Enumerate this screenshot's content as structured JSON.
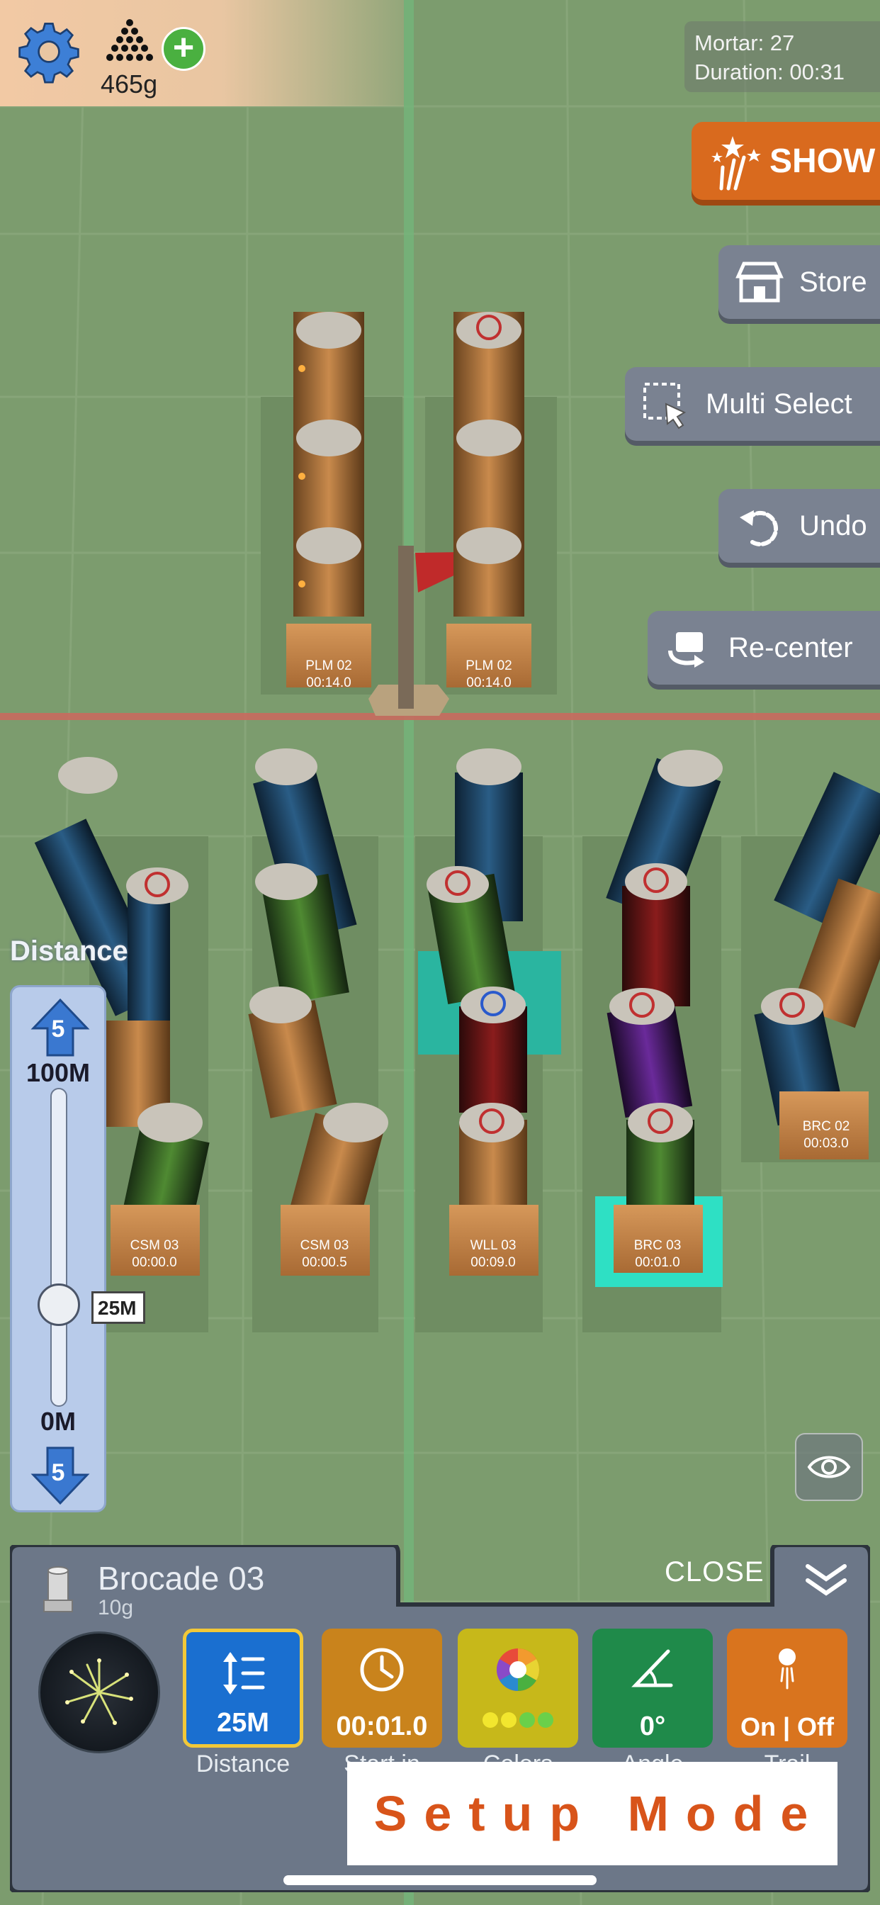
{
  "resources": {
    "grams": "465g"
  },
  "info": {
    "mortar": "Mortar: 27",
    "duration": "Duration: 00:31"
  },
  "buttons": {
    "show": "SHOW",
    "store": "Store",
    "multi_select": "Multi Select",
    "undo": "Undo",
    "recenter": "Re-center"
  },
  "distance": {
    "label": "Distance",
    "step_up": "5",
    "max": "100M",
    "current": "25M",
    "min": "0M",
    "step_down": "5",
    "level_fraction": 0.25
  },
  "mortars": {
    "top_left": {
      "name": "PLM 02",
      "time": "00:14.0"
    },
    "top_right": {
      "name": "PLM 02",
      "time": "00:14.0"
    },
    "csm_a": {
      "name": "CSM 03",
      "time": "00:00.0"
    },
    "csm_b": {
      "name": "CSM 03",
      "time": "00:00.5"
    },
    "wll": {
      "name": "WLL 03",
      "time": "00:09.0"
    },
    "brc_selected": {
      "name": "BRC 03",
      "time": "00:01.0"
    },
    "brc_right": {
      "name": "BRC 02",
      "time": "00:03.0"
    }
  },
  "selected_item": {
    "name": "Brocade 03",
    "weight": "10g",
    "close_label": "CLOSE"
  },
  "settings": [
    {
      "label": "Distance",
      "value": "25M",
      "icon": "distance-icon",
      "color": "#1a6fd0"
    },
    {
      "label": "Start in",
      "value": "00:01.0",
      "icon": "clock-icon",
      "color": "#c9831c"
    },
    {
      "label": "Colors",
      "value": "",
      "icon": "color-wheel-icon",
      "color": "#c7b81a"
    },
    {
      "label": "Angle",
      "value": "0°",
      "icon": "angle-icon",
      "color": "#1f8a4a"
    },
    {
      "label": "Trail",
      "value": "On | Off",
      "icon": "trail-icon",
      "color": "#d9741e"
    }
  ],
  "mode_banner": "Setup Mode"
}
